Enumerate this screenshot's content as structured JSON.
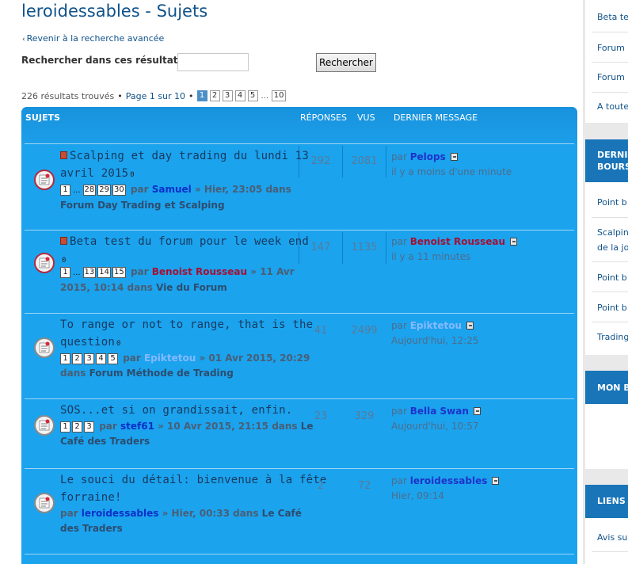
{
  "page": {
    "title": "leroidessables - Sujets",
    "back_link": "Revenir à la recherche avancée",
    "search_label": "Rechercher dans ces résultats:",
    "search_value": "",
    "search_button": "Rechercher"
  },
  "pagination": {
    "results_text": "226 résultats trouvés",
    "separator": "•",
    "page_text": "Page 1 sur 10",
    "pages": [
      "1",
      "2",
      "3",
      "4",
      "5"
    ],
    "ellipsis": "...",
    "last_page": "10",
    "current": "1"
  },
  "table": {
    "col_topics": "SUJETS",
    "col_replies": "RÉPONSES",
    "col_views": "VUS",
    "col_last": "DERNIER MESSAGE"
  },
  "topics": [
    {
      "title_line1": "Scalping et day trading du lundi 13",
      "title_line2": "avril 2015",
      "pages": [
        "1",
        "28",
        "29",
        "30"
      ],
      "ellipsis": "...",
      "by": "par",
      "author": "Samuel",
      "date": "» Hier, 23:05 dans",
      "forum": "Forum Day Trading et Scalping",
      "replies": "292",
      "views": "2081",
      "last_by": "par",
      "last_user": "Pelops",
      "last_time": "il y a moins d'une minute"
    },
    {
      "title_line1": "Beta test du forum pour le week end",
      "pages": [
        "1",
        "13",
        "14",
        "15"
      ],
      "ellipsis": "...",
      "by": "par",
      "author": "Benoist Rousseau",
      "date": "» 11 Avr",
      "date2": "2015, 10:14 dans",
      "forum": "Vie du Forum",
      "replies": "147",
      "views": "1135",
      "last_by": "par",
      "last_user": "Benoist Rousseau",
      "last_time": "il y a 11 minutes"
    },
    {
      "title_line1": "To range or not to range, that is the",
      "title_line2": "question",
      "pages": [
        "1",
        "2",
        "3",
        "4",
        "5"
      ],
      "by": "par",
      "author": "Epiktetou",
      "date": "» 01 Avr 2015, 20:29",
      "date2": "dans",
      "forum": "Forum Méthode de Trading",
      "replies": "41",
      "views": "2499",
      "last_by": "par",
      "last_user": "Epiktetou",
      "last_time": "Aujourd'hui, 12:25"
    },
    {
      "title_line1": "SOS...et si on grandissait, enfin.",
      "pages": [
        "1",
        "2",
        "3"
      ],
      "by": "par",
      "author": "stef61",
      "date": "» 10 Avr 2015, 21:15 dans",
      "forum_a": "Le",
      "forum_b": "Café des Traders",
      "replies": "23",
      "views": "329",
      "last_by": "par",
      "last_user": "Bella Swan",
      "last_time": "Aujourd'hui, 10:57"
    },
    {
      "title_line1": "Le souci du détail: bienvenue à la fête",
      "title_line2": "forraine!",
      "by": "par",
      "author": "leroidessables",
      "date": "» Hier, 00:33 dans",
      "forum_a": "Le Café",
      "forum_b": "des Traders",
      "replies": "2",
      "views": "72",
      "last_by": "par",
      "last_user": "leroidessables",
      "last_time": "Hier, 09:14"
    }
  ],
  "sidebar": {
    "links_top": [
      "Beta te",
      "Forum",
      "Forum",
      "A toutes"
    ],
    "head_derniers_1": "DERNI",
    "head_derniers_2": "BOURS",
    "links_mid": [
      "Point b",
      "Scalpin",
      "de la jo",
      "Point b",
      "Point b",
      "Trading"
    ],
    "head_mon": "MON B",
    "head_liens": "LIENS",
    "links_bottom": [
      "Avis su"
    ]
  },
  "colors": {
    "panel": "#1ba3ee",
    "header": "#1892dc",
    "link": "#105289",
    "sidebar_head": "#1975b8"
  }
}
